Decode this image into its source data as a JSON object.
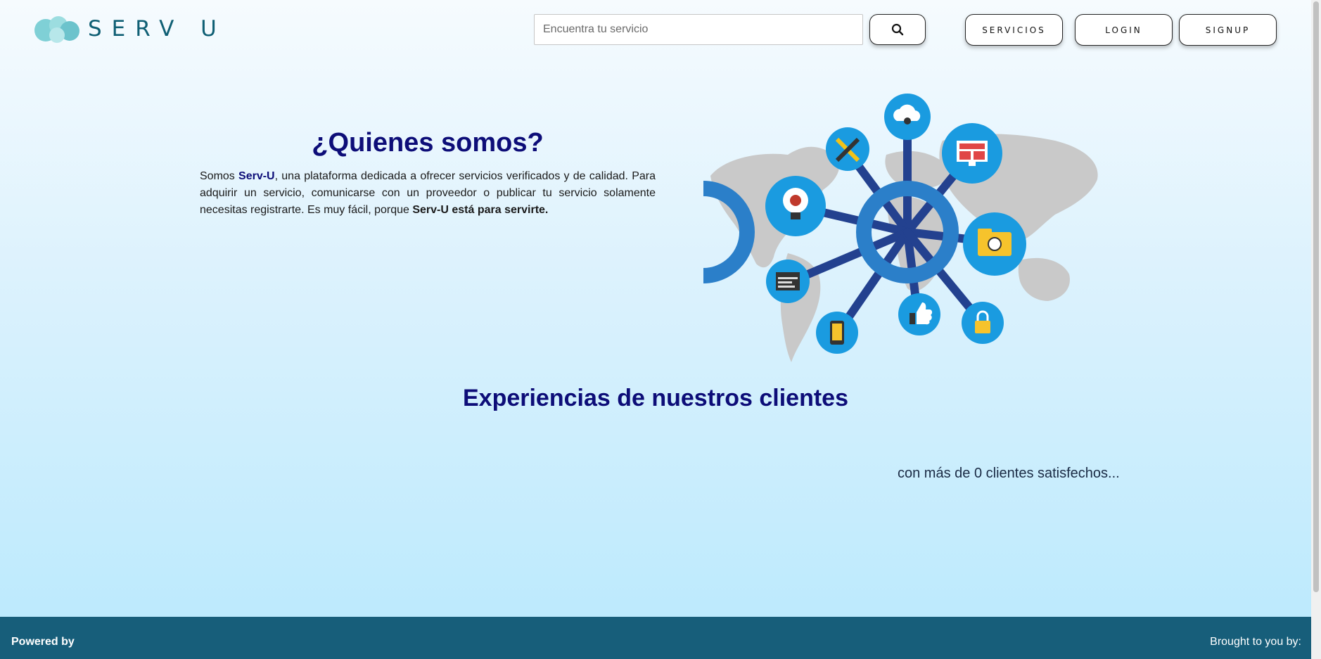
{
  "header": {
    "logo_text": "SERV U",
    "search_placeholder": "Encuentra tu servicio",
    "search_icon": "search-icon",
    "nav": [
      {
        "label": "SERVICIOS"
      },
      {
        "label": "LOGIN"
      },
      {
        "label": "SIGNUP"
      }
    ]
  },
  "about": {
    "title": "¿Quienes somos?",
    "text_1": "Somos ",
    "brand": "Serv-U",
    "text_2": ", una plataforma dedicada a ofrecer servicios verificados y de calidad. Para adquirir un servicio, comunicarse con un proveedor o publicar tu servicio solamente necesitas registrarte. Es muy fácil, porque ",
    "tagline": "Serv-U está para servirte."
  },
  "experiences": {
    "title": "Experiencias de nuestros clientes",
    "clients_text": "con más de 0 clientes satisfechos..."
  },
  "footer": {
    "left": "Powered by",
    "right": "Brought to you by:"
  },
  "colors": {
    "heading": "#0d0d78",
    "footer_bg": "#175e7a",
    "logo": "#0f5f74",
    "icon_blue": "#1a9be0",
    "hub_blue": "#2b7fc9",
    "spoke": "#23418f"
  }
}
